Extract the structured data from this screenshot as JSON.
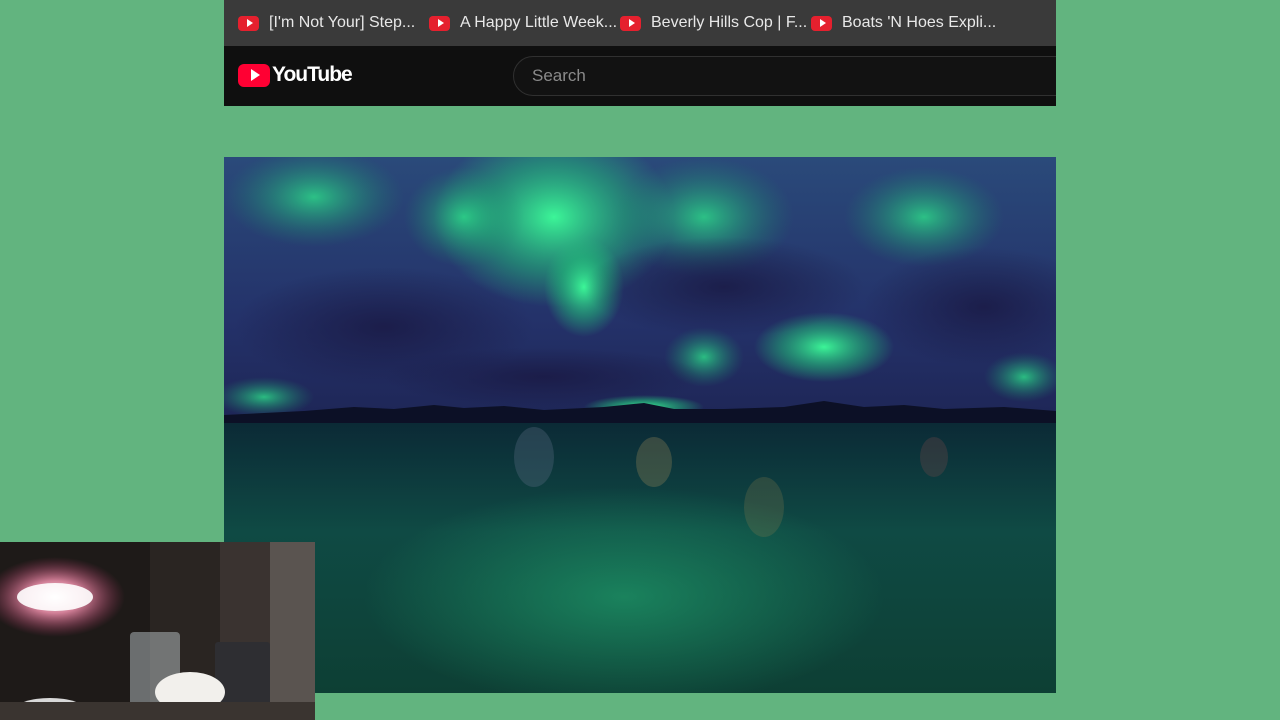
{
  "bookmarks": [
    {
      "label": "[I'm Not Your] Step...",
      "icon": "youtube-icon"
    },
    {
      "label": "A Happy Little Week...",
      "icon": "youtube-icon"
    },
    {
      "label": "Beverly Hills Cop | F...",
      "icon": "youtube-icon"
    },
    {
      "label": "Boats 'N Hoes Expli...",
      "icon": "youtube-icon"
    }
  ],
  "header": {
    "logo_text": "YouTube",
    "search_placeholder": "Search"
  },
  "colors": {
    "background": "#62b47f",
    "bookmarks_bar": "#3a3a3a",
    "header": "#0f0f0f",
    "brand_red": "#ff0033"
  }
}
